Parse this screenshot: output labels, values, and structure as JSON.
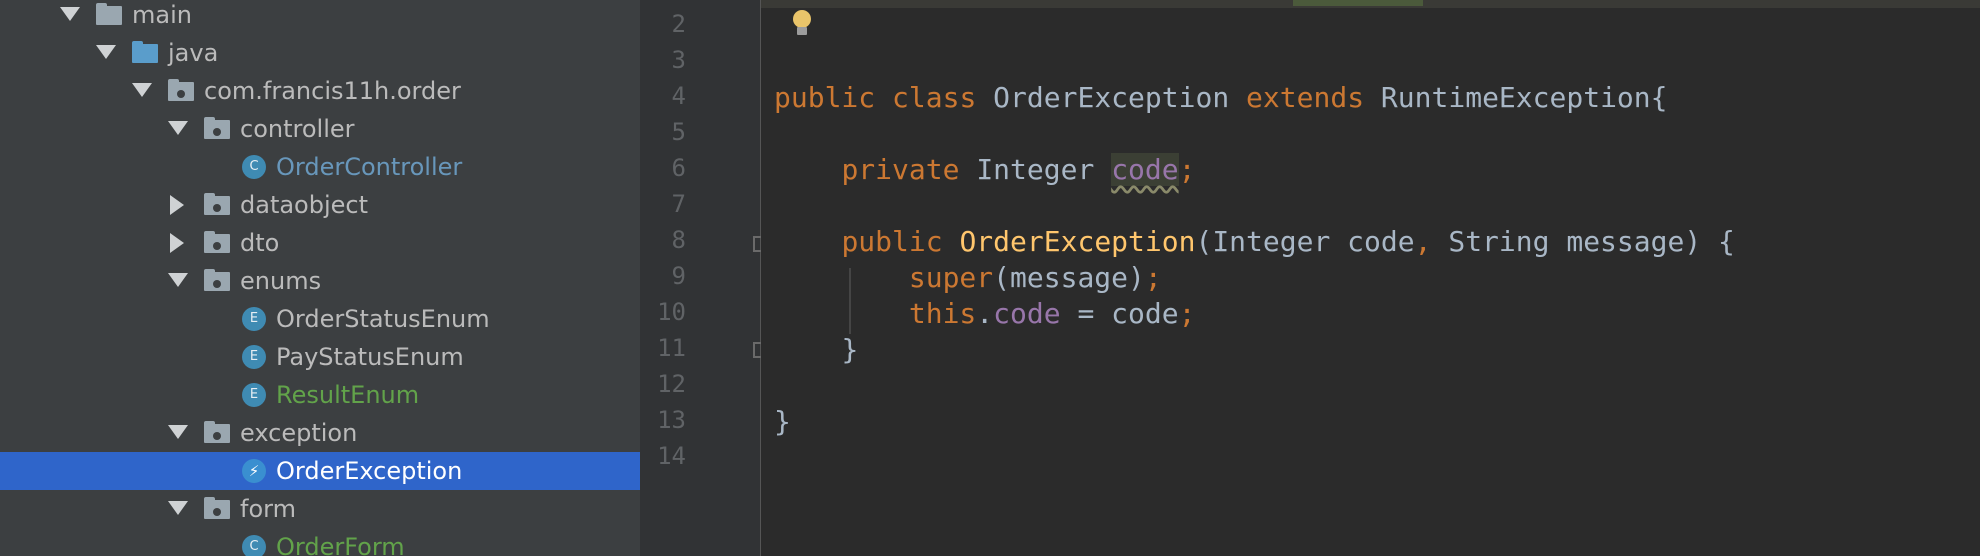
{
  "tree": {
    "items": [
      {
        "label": "main",
        "icon": "folder-icon"
      },
      {
        "label": "java",
        "icon": "source-folder-icon"
      },
      {
        "label": "com.francis11h.order",
        "icon": "package-icon"
      },
      {
        "label": "controller",
        "icon": "package-icon"
      },
      {
        "label": "OrderController",
        "icon": "class-icon",
        "badge": "C"
      },
      {
        "label": "dataobject",
        "icon": "package-icon"
      },
      {
        "label": "dto",
        "icon": "package-icon"
      },
      {
        "label": "enums",
        "icon": "package-icon"
      },
      {
        "label": "OrderStatusEnum",
        "icon": "enum-icon",
        "badge": "E"
      },
      {
        "label": "PayStatusEnum",
        "icon": "enum-icon",
        "badge": "E"
      },
      {
        "label": "ResultEnum",
        "icon": "enum-icon",
        "badge": "E"
      },
      {
        "label": "exception",
        "icon": "package-icon"
      },
      {
        "label": "OrderException",
        "icon": "exception-class-icon",
        "badge": "⚡"
      },
      {
        "label": "form",
        "icon": "package-icon"
      },
      {
        "label": "OrderForm",
        "icon": "class-icon",
        "badge": "C"
      }
    ],
    "selected": "OrderException"
  },
  "editor": {
    "line_numbers": [
      "2",
      "3",
      "4",
      "5",
      "6",
      "7",
      "8",
      "9",
      "10",
      "11",
      "12",
      "13",
      "14"
    ],
    "code": {
      "l4_public": "public",
      "l4_class": "class",
      "l4_name": "OrderException",
      "l4_extends": "extends",
      "l4_super": "RuntimeException{",
      "l6_private": "private",
      "l6_type": "Integer",
      "l6_field": "code",
      "l6_semi": ";",
      "l8_public": "public",
      "l8_ctor": "OrderException",
      "l8_params_a": "(Integer code",
      "l8_comma": ",",
      "l8_params_b": " String message) {",
      "l9_super": "super",
      "l9_rest": "(message)",
      "l9_semi": ";",
      "l10_this": "this",
      "l10_dot": ".",
      "l10_field": "code",
      "l10_rest": " = code",
      "l10_semi": ";",
      "l11_brace": "}",
      "l13_brace": "}"
    }
  },
  "colors": {
    "tree_bg": "#3c3f41",
    "selection": "#2f65ca",
    "editor_bg": "#2b2b2b",
    "keyword": "#cc7832",
    "method": "#ffc66d",
    "field": "#9876aa"
  }
}
